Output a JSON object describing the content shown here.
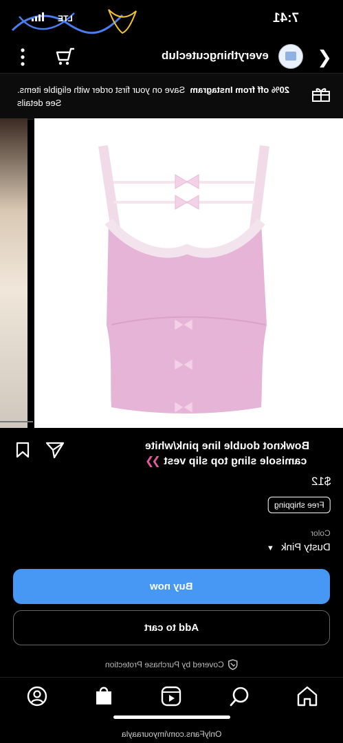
{
  "status": {
    "time": "7:41",
    "network": "LTE",
    "watermark": "TifitBony"
  },
  "header": {
    "shop_name": "everythingcuteclub"
  },
  "promo": {
    "highlight": "20% off from Instagram",
    "text": "Save on your first order with eligible items. See details"
  },
  "product": {
    "title": "Bowknot double line pink/white camisole sling top slip vest",
    "price": "$12",
    "shipping": "Free shipping",
    "color_label": "Color",
    "color_value": "Dusty Pink"
  },
  "actions": {
    "buy": "Buy now",
    "cart": "Add to cart"
  },
  "protection": "Covered by Purchase Protection",
  "nav": [
    "home-icon",
    "search-icon",
    "reels-icon",
    "shop-icon",
    "profile-icon"
  ],
  "footer": "OnlyFans.com/imyouraayla",
  "colors": {
    "accent": "#4797f5",
    "pink": "#e05a9c",
    "garment": "#e6b4d6"
  }
}
